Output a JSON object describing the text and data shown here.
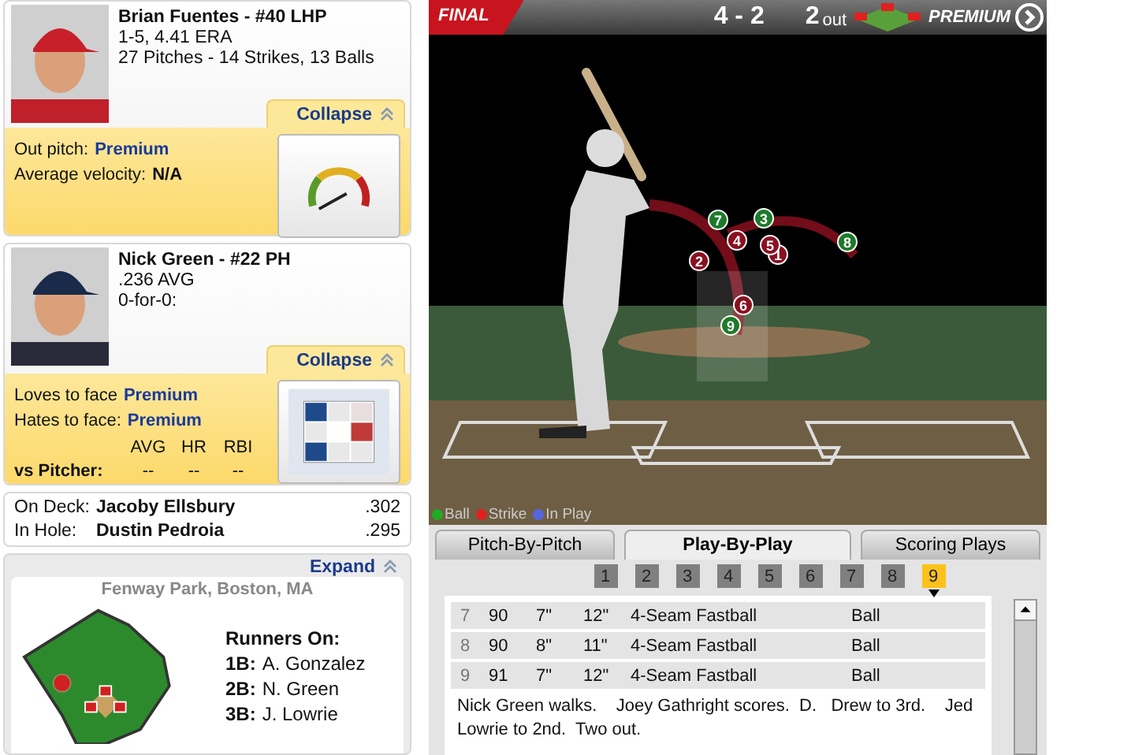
{
  "pitcher": {
    "name": "Brian Fuentes - #40 LHP",
    "record": "1-5, 4.41 ERA",
    "pitches": "27 Pitches - 14 Strikes, 13 Balls",
    "toggle": "Collapse",
    "stats": [
      {
        "label": "Out pitch:",
        "value": "Premium",
        "kind": "link"
      },
      {
        "label": "Average velocity:",
        "value": "N/A",
        "kind": "bold"
      }
    ]
  },
  "batter": {
    "name": "Nick Green - #22 PH",
    "avg": ".236 AVG",
    "today": "0-for-0:",
    "toggle": "Collapse",
    "stats": [
      {
        "label": "Loves to face",
        "value": "Premium",
        "kind": "link"
      },
      {
        "label": "Hates to face:",
        "value": "Premium",
        "kind": "link"
      }
    ],
    "vs": {
      "label": "vs Pitcher:",
      "columns": [
        "AVG",
        "HR",
        "RBI"
      ],
      "values": [
        "--",
        "--",
        "--"
      ]
    }
  },
  "due_up": [
    {
      "label": "On Deck:",
      "name": "Jacoby Ellsbury",
      "avg": ".302"
    },
    {
      "label": "In Hole:",
      "name": "Dustin Pedroia",
      "avg": ".295"
    }
  ],
  "field": {
    "toggle": "Expand",
    "venue": "Fenway Park, Boston, MA",
    "runners_title": "Runners On:",
    "runners": [
      {
        "base": "1B:",
        "name": "A. Gonzalez"
      },
      {
        "base": "2B:",
        "name": "N. Green"
      },
      {
        "base": "3B:",
        "name": "J. Lowrie"
      }
    ]
  },
  "scoreboard": {
    "status": "FINAL",
    "score": "4 - 2",
    "outs": "2",
    "outs_label": "out",
    "premium": "PREMIUM"
  },
  "pitches": [
    {
      "label": "1",
      "kind": "strike"
    },
    {
      "label": "2",
      "kind": "strike"
    },
    {
      "label": "3",
      "kind": "ball"
    },
    {
      "label": "4",
      "kind": "strike"
    },
    {
      "label": "5",
      "kind": "strike"
    },
    {
      "label": "6",
      "kind": "strike"
    },
    {
      "label": "7",
      "kind": "ball"
    },
    {
      "label": "8",
      "kind": "ball"
    },
    {
      "label": "9",
      "kind": "ball"
    }
  ],
  "legend": [
    {
      "label": "Ball",
      "color": "#22aa22"
    },
    {
      "label": "Strike",
      "color": "#dd2222"
    },
    {
      "label": "In Play",
      "color": "#5566dd"
    }
  ],
  "tabs": [
    {
      "label": "Pitch-By-Pitch",
      "selected": false
    },
    {
      "label": "Play-By-Play",
      "selected": true
    },
    {
      "label": "Scoring Plays",
      "selected": false
    }
  ],
  "innings": [
    {
      "label": "1",
      "selected": false
    },
    {
      "label": "2",
      "selected": false
    },
    {
      "label": "3",
      "selected": false
    },
    {
      "label": "4",
      "selected": false
    },
    {
      "label": "5",
      "selected": false
    },
    {
      "label": "6",
      "selected": false
    },
    {
      "label": "7",
      "selected": false
    },
    {
      "label": "8",
      "selected": false
    },
    {
      "label": "9",
      "selected": true
    }
  ],
  "pitch_rows": [
    [
      "7",
      "90",
      "7\"",
      "12\"",
      "4-Seam Fastball",
      "Ball"
    ],
    [
      "8",
      "90",
      "8\"",
      "11\"",
      "4-Seam Fastball",
      "Ball"
    ],
    [
      "9",
      "91",
      "7\"",
      "12\"",
      "4-Seam Fastball",
      "Ball"
    ]
  ],
  "description": "Nick Green walks.    Joey Gathright scores.  D.   Drew to 3rd.    Jed Lowrie to 2nd.  Two out."
}
